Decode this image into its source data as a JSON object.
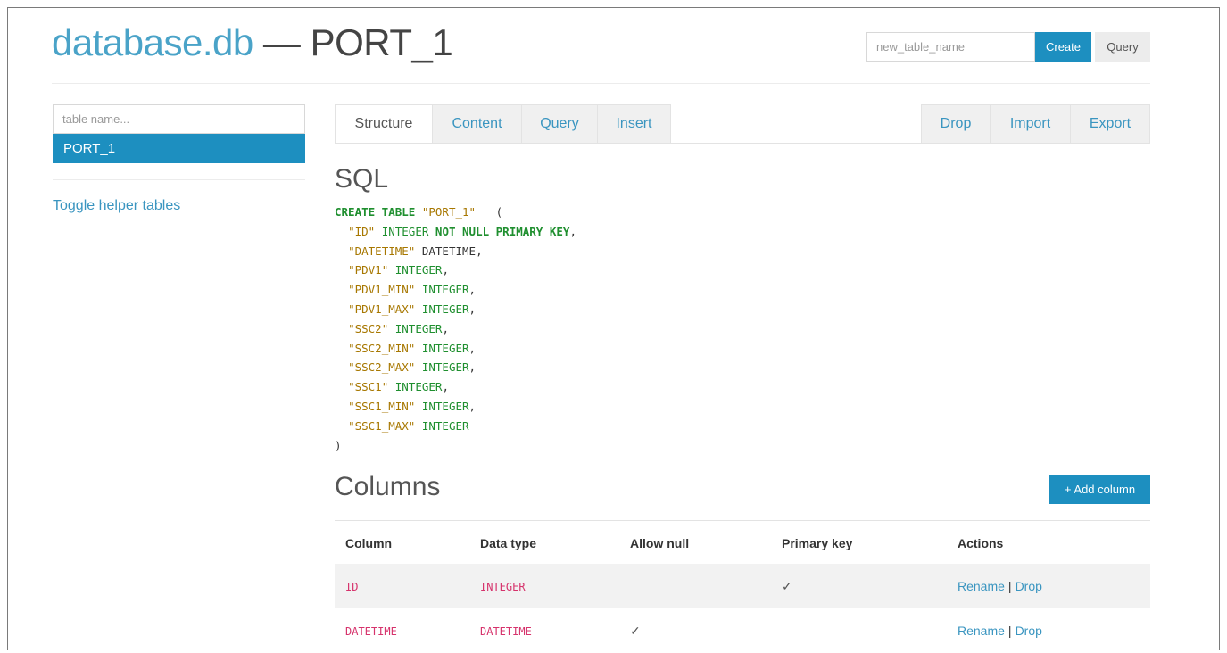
{
  "header": {
    "db_name": "database.db",
    "separator": "—",
    "table_name": "PORT_1",
    "new_table_placeholder": "new_table_name",
    "create_label": "Create",
    "query_label": "Query"
  },
  "sidebar": {
    "search_placeholder": "table name...",
    "tables": [
      "PORT_1"
    ],
    "toggle_helper_label": "Toggle helper tables"
  },
  "tabs": {
    "left": [
      "Structure",
      "Content",
      "Query",
      "Insert"
    ],
    "right": [
      "Drop",
      "Import",
      "Export"
    ],
    "active": "Structure"
  },
  "sql_section": {
    "title": "SQL",
    "statement": "CREATE TABLE \"PORT_1\" (\"ID\" INTEGER NOT NULL PRIMARY KEY, \"DATETIME\" DATETIME, \"PDV1\" INTEGER, \"PDV1_MIN\" INTEGER, \"PDV1_MAX\" INTEGER, \"SSC2\" INTEGER, \"SSC2_MIN\" INTEGER, \"SSC2_MAX\" INTEGER, \"SSC1\" INTEGER, \"SSC1_MIN\" INTEGER, \"SSC1_MAX\" INTEGER)",
    "create_kw": "CREATE TABLE",
    "table_str": "\"PORT_1\"",
    "open_paren": "(",
    "close_paren": ")",
    "columns": [
      {
        "name": "\"ID\"",
        "type": "INTEGER",
        "extra": "NOT NULL PRIMARY KEY",
        "comma": ","
      },
      {
        "name": "\"DATETIME\"",
        "type": "DATETIME",
        "extra": "",
        "comma": ","
      },
      {
        "name": "\"PDV1\"",
        "type": "INTEGER",
        "extra": "",
        "comma": ","
      },
      {
        "name": "\"PDV1_MIN\"",
        "type": "INTEGER",
        "extra": "",
        "comma": ","
      },
      {
        "name": "\"PDV1_MAX\"",
        "type": "INTEGER",
        "extra": "",
        "comma": ","
      },
      {
        "name": "\"SSC2\"",
        "type": "INTEGER",
        "extra": "",
        "comma": ","
      },
      {
        "name": "\"SSC2_MIN\"",
        "type": "INTEGER",
        "extra": "",
        "comma": ","
      },
      {
        "name": "\"SSC2_MAX\"",
        "type": "INTEGER",
        "extra": "",
        "comma": ","
      },
      {
        "name": "\"SSC1\"",
        "type": "INTEGER",
        "extra": "",
        "comma": ","
      },
      {
        "name": "\"SSC1_MIN\"",
        "type": "INTEGER",
        "extra": "",
        "comma": ","
      },
      {
        "name": "\"SSC1_MAX\"",
        "type": "INTEGER",
        "extra": "",
        "comma": ""
      }
    ]
  },
  "columns_section": {
    "title": "Columns",
    "add_column_label": "+ Add column",
    "headers": [
      "Column",
      "Data type",
      "Allow null",
      "Primary key",
      "Actions"
    ],
    "rows": [
      {
        "column": "ID",
        "type": "INTEGER",
        "allow_null": "",
        "primary_key": "✓",
        "rename": "Rename",
        "sep": "|",
        "drop": "Drop"
      },
      {
        "column": "DATETIME",
        "type": "DATETIME",
        "allow_null": "✓",
        "primary_key": "",
        "rename": "Rename",
        "sep": "|",
        "drop": "Drop"
      }
    ]
  },
  "colors": {
    "accent": "#1d8fc0",
    "link": "#3a95c0",
    "sql_keyword": "#1f8f2f",
    "sql_string": "#a77700",
    "code_pink": "#d6336c"
  }
}
